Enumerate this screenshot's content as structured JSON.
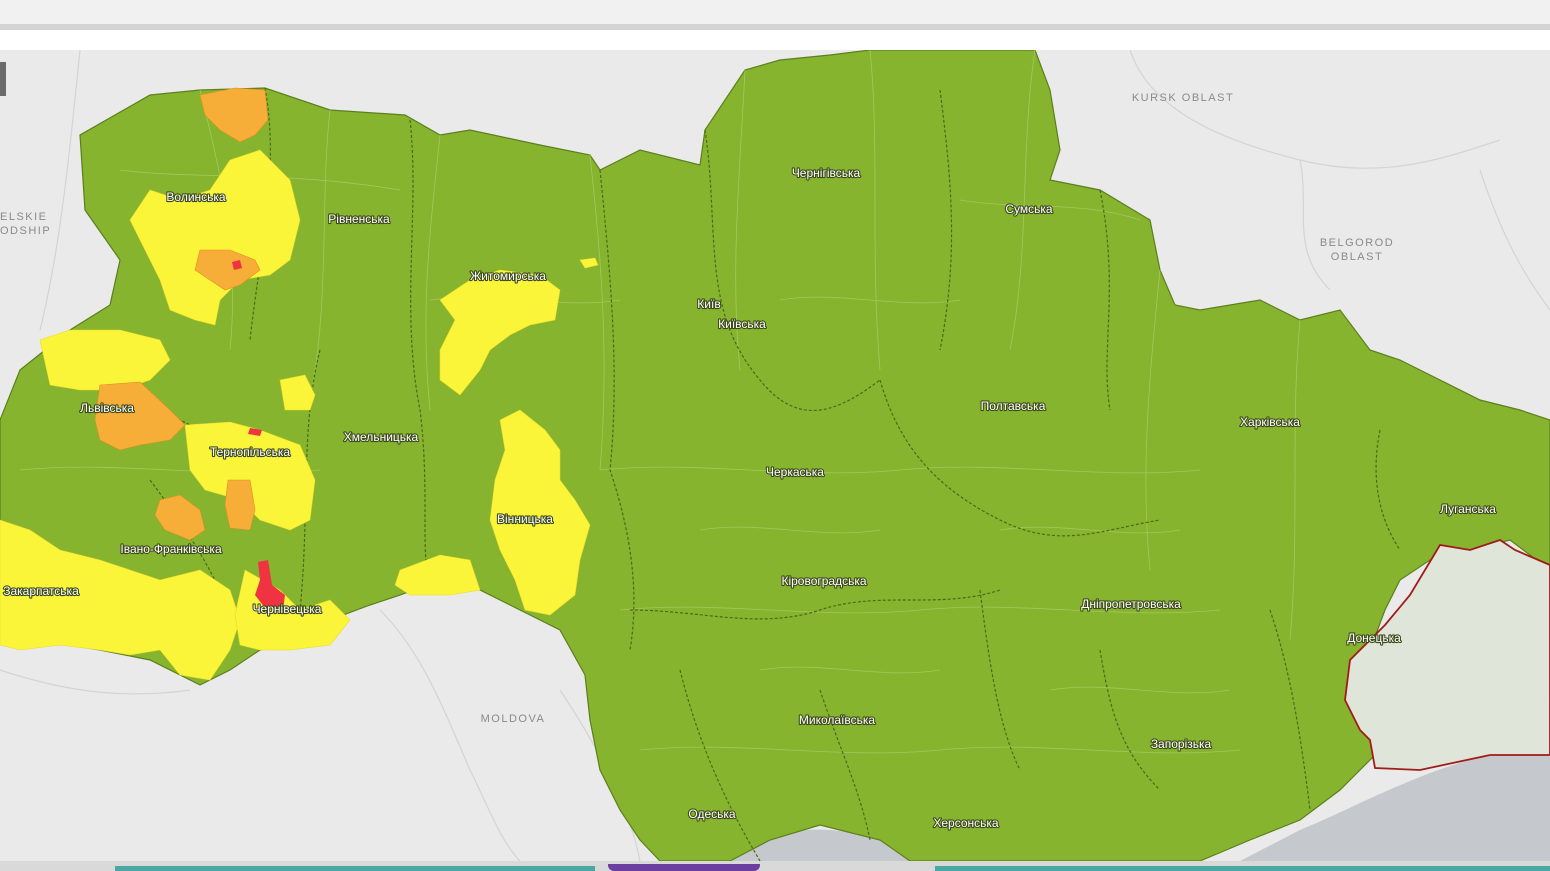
{
  "map": {
    "colors": {
      "green": "#86b42e",
      "yellow": "#fbf53a",
      "orange": "#f7ae38",
      "red": "#ef3340",
      "occupied": "#dfe5d8",
      "background": "#eaeaea",
      "sea": "#c5c8cc",
      "border_red": "#a11b1b"
    },
    "regions": [
      {
        "label": "Волинська",
        "zone": "yellow"
      },
      {
        "label": "Рівненська",
        "zone": "green"
      },
      {
        "label": "Житомирська",
        "zone": "yellow"
      },
      {
        "label": "Чернігівська",
        "zone": "green"
      },
      {
        "label": "Сумська",
        "zone": "green"
      },
      {
        "label": "Київ",
        "zone": "green"
      },
      {
        "label": "Київська",
        "zone": "green"
      },
      {
        "label": "Львівська",
        "zone": "orange"
      },
      {
        "label": "Тернопільська",
        "zone": "yellow"
      },
      {
        "label": "Хмельницька",
        "zone": "green"
      },
      {
        "label": "Полтавська",
        "zone": "green"
      },
      {
        "label": "Харківська",
        "zone": "green"
      },
      {
        "label": "Черкаська",
        "zone": "green"
      },
      {
        "label": "Вінницька",
        "zone": "yellow"
      },
      {
        "label": "Луганська",
        "zone": "green"
      },
      {
        "label": "Івано-Франківська",
        "zone": "orange"
      },
      {
        "label": "Закарпатська",
        "zone": "yellow"
      },
      {
        "label": "Чернівецька",
        "zone": "red"
      },
      {
        "label": "Кіровоградська",
        "zone": "green"
      },
      {
        "label": "Дніпропетровська",
        "zone": "green"
      },
      {
        "label": "Донецька",
        "zone": "green"
      },
      {
        "label": "Миколаївська",
        "zone": "green"
      },
      {
        "label": "Запорізька",
        "zone": "green"
      },
      {
        "label": "Одеська",
        "zone": "green"
      },
      {
        "label": "Херсонська",
        "zone": "green"
      }
    ],
    "basemap_labels": {
      "kursk": "KURSK OBLAST",
      "belgorod_1": "BELGOROD",
      "belgorod_2": "OBLAST",
      "moldova": "MOLDOVA",
      "west_1": "ELSKIE",
      "west_2": "ODSHIP"
    }
  }
}
